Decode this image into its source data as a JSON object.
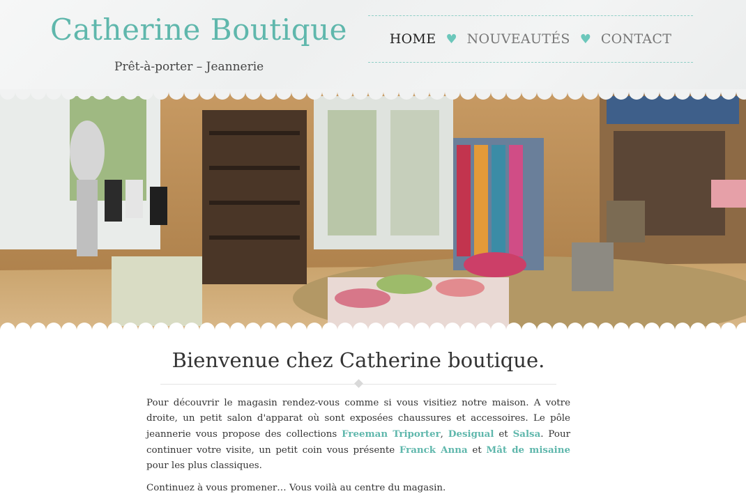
{
  "header": {
    "brand_title": "Catherine Boutique",
    "brand_subtitle": "Prêt-à-porter – Jeannerie",
    "nav": {
      "home": "HOME",
      "nouveautes": "NOUVEAUTÉS",
      "contact": "CONTACT",
      "separator": "♥"
    }
  },
  "hero": {
    "description": "Panoramic photo of the boutique interior"
  },
  "main": {
    "welcome_title": "Bienvenue chez Catherine boutique.",
    "p1_a": "Pour découvrir le magasin rendez-vous comme si vous visitiez notre maison. A votre droite, un petit salon d'apparat où sont exposées chaussures et accessoires. Le pôle jeannerie vous propose des collections ",
    "link_freeman": "Freeman Triporter",
    "p1_b": ", ",
    "link_desigual": "Desigual",
    "p1_c": " et ",
    "link_salsa": "Salsa",
    "p1_d": ". Pour continuer votre visite, un petit coin vous présente ",
    "link_franck": "Franck Anna",
    "p1_e": " et ",
    "link_mat": "Mât de misaine",
    "p1_f": " pour les plus classiques.",
    "p2": "Continuez à vous promener… Vous voilà au centre du magasin."
  },
  "colors": {
    "accent": "#5fb7ac",
    "text": "#333333"
  }
}
